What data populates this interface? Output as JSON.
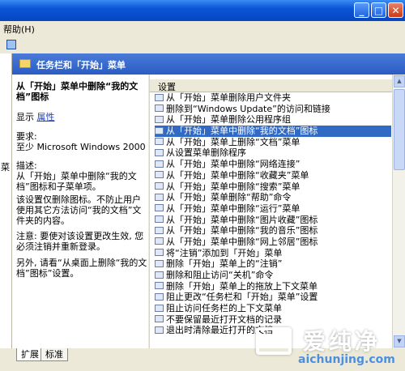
{
  "window": {
    "controls": [
      "_",
      "□",
      "✕"
    ]
  },
  "menubar": {
    "help": "帮助(H)"
  },
  "header": {
    "title": "任务栏和「开始」菜单"
  },
  "description": {
    "title": "从「开始」菜单中删除“我的文档”图标",
    "display_label": "显示",
    "display_link": "属性",
    "requirements_label": "要求:",
    "requirements_value": "至少 Microsoft Windows 2000",
    "description_label": "描述:",
    "description_text": "从「开始」菜单中删除“我的文档”图标和子菜单项。",
    "para2": "该设置仅删除图标。不防止用户使用其它方法访问“我的文档”文件夹的内容。",
    "para3": "注意: 要使对该设置更改生效, 您必须注销并重新登录。",
    "para4": "另外, 请看“从桌面上删除“我的文档”图标”设置。"
  },
  "left_strip": {
    "label": "菜"
  },
  "list": {
    "column_header": "设置",
    "selected_index": 4,
    "items": [
      "从「开始」菜单删除用户文件夹",
      "删除到“Windows Update”的访问和链接",
      "从「开始」菜单删除公用程序组",
      "从「开始」菜单中删除“我的文档”图标",
      "从「开始」菜单上删除“文档”菜单",
      "从设置菜单删除程序",
      "从「开始」菜单中删除“网络连接”",
      "从「开始」菜单中删除“收藏夹”菜单",
      "从「开始」菜单中删除“搜索”菜单",
      "从「开始」菜单删除“帮助”命令",
      "从「开始」菜单中删除“运行”菜单",
      "从「开始」菜单中删除“图片收藏”图标",
      "从「开始」菜单中删除“我的音乐”图标",
      "从「开始」菜单中删除“网上邻居”图标",
      "将“注销”添加到「开始」菜单",
      "删除「开始」菜单上的“注销”",
      "删除和阻止访问“关机”命令",
      "删除「开始」菜单上的拖放上下文菜单",
      "阻止更改“任务栏和「开始」菜单”设置",
      "阻止访问任务栏的上下文菜单",
      "不要保留最近打开文档的记录",
      "退出时清除最近打开的文档"
    ]
  },
  "tabs": {
    "extended": "扩展",
    "standard": "标准"
  },
  "watermark": {
    "brand": "爱纯净",
    "url": "aichunjing.com"
  }
}
